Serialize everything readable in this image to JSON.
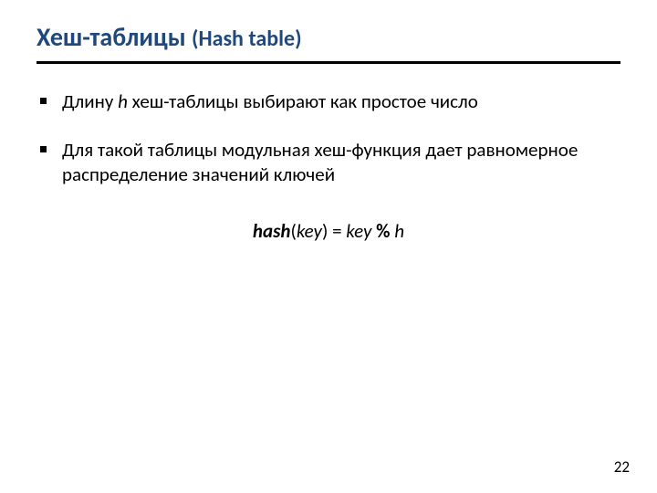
{
  "title": {
    "main": "Хеш-таблицы",
    "sub": "(Hash table)"
  },
  "bullets": [
    {
      "pre": "Длину ",
      "var1": "h",
      "post": " хеш-таблицы выбирают как простое число"
    },
    {
      "text": "Для такой таблицы модульная хеш-функция дает равномерное распределение значений ключей"
    }
  ],
  "formula": {
    "fn": "hash",
    "open": "(",
    "arg1": "key",
    "close": ")",
    "eq": " = ",
    "arg2": "key",
    "op": " % ",
    "mod": "h"
  },
  "pageNumber": "22"
}
